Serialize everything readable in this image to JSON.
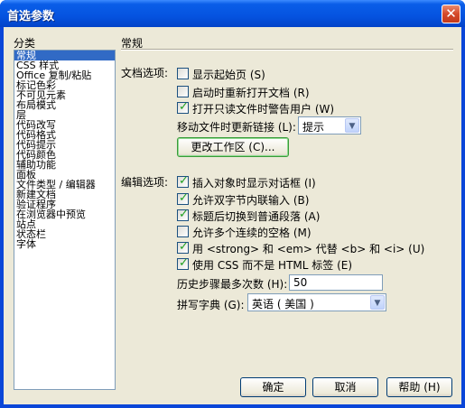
{
  "window": {
    "title": "首选参数",
    "close_glyph": "✕"
  },
  "category": {
    "label": "分类",
    "items": [
      "常规",
      "CSS 样式",
      "Office 复制/粘贴",
      "标记色彩",
      "不可见元素",
      "布局模式",
      "层",
      "代码改写",
      "代码格式",
      "代码提示",
      "代码颜色",
      "辅助功能",
      "面板",
      "文件类型 / 编辑器",
      "新建文档",
      "验证程序",
      "在浏览器中预览",
      "站点",
      "状态栏",
      "字体"
    ],
    "selected_index": 0
  },
  "panel": {
    "heading": "常规"
  },
  "document_options": {
    "label": "文档选项:",
    "show_start_page": {
      "label": "显示起始页 (S)",
      "checked": false
    },
    "reopen_docs": {
      "label": "启动时重新打开文档 (R)",
      "checked": false
    },
    "warn_readonly": {
      "label": "打开只读文件时警告用户 (W)",
      "checked": true
    },
    "update_links_label": "移动文件时更新链接 (L):",
    "update_links_value": "提示",
    "change_workspace_button": "更改工作区 (C)..."
  },
  "editing_options": {
    "label": "编辑选项:",
    "items": [
      {
        "label": "插入对象时显示对话框 (I)",
        "checked": true
      },
      {
        "label": "允许双字节内联输入 (B)",
        "checked": true
      },
      {
        "label": "标题后切换到普通段落 (A)",
        "checked": true
      },
      {
        "label": "允许多个连续的空格 (M)",
        "checked": false
      },
      {
        "label": "用 <strong> 和 <em> 代替 <b> 和 <i> (U)",
        "checked": true
      },
      {
        "label": "使用 CSS 而不是 HTML 标签 (E)",
        "checked": true
      }
    ],
    "history_label": "历史步骤最多次数 (H):",
    "history_value": "50",
    "spelling_label": "拼写字典 (G):",
    "spelling_value": "英语 ( 美国 )"
  },
  "buttons": {
    "ok": "确定",
    "cancel": "取消",
    "help": "帮助 (H)"
  },
  "colors": {
    "title_bar": "#0553e0",
    "dialog_bg": "#ece9d8",
    "selection": "#316ac5",
    "check": "#21a121"
  }
}
